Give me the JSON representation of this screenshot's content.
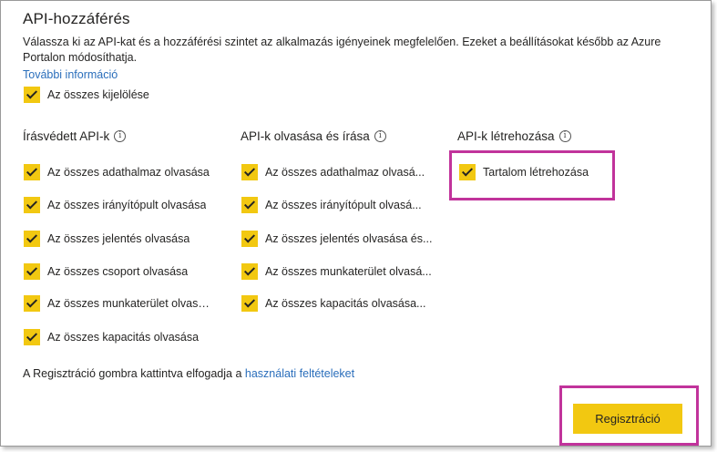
{
  "header": {
    "title": "API-hozzáférés",
    "description": "Válassza ki az API-kat és a hozzáférési szintet az alkalmazás igényeinek megfelelően. Ezeket a beállításokat később az Azure Portalon módosíthatja.",
    "more_info_link": "További információ"
  },
  "select_all": {
    "label": "Az összes kijelölése",
    "checked": true
  },
  "columns": [
    {
      "title": "Írásvédett API-k",
      "info_icon": "info-icon",
      "items": [
        {
          "label": "Az összes adathalmaz olvasása",
          "checked": true
        },
        {
          "label": "Az összes irányítópult olvasása",
          "checked": true
        },
        {
          "label": "Az összes jelentés olvasása",
          "checked": true
        },
        {
          "label": "Az összes csoport olvasása",
          "checked": true
        },
        {
          "label": "Az összes munkaterület olvasása",
          "checked": true
        },
        {
          "label": "Az összes kapacitás olvasása",
          "checked": true
        }
      ]
    },
    {
      "title": "API-k olvasása és írása",
      "info_icon": "info-icon",
      "items": [
        {
          "label": "Az összes adathalmaz olvasá...",
          "checked": true
        },
        {
          "label": "Az összes irányítópult olvasá...",
          "checked": true
        },
        {
          "label": "Az összes jelentés olvasása és...",
          "checked": true
        },
        {
          "label": "Az összes munkaterület olvasá...",
          "checked": true
        },
        {
          "label": "Az összes kapacitás olvasása...",
          "checked": true
        }
      ]
    },
    {
      "title": "API-k létrehozása",
      "info_icon": "info-icon",
      "items": [
        {
          "label": "Tartalom létrehozása",
          "checked": true
        }
      ]
    }
  ],
  "footer": {
    "terms_prefix": "A Regisztráció gombra kattintva elfogadja a ",
    "terms_link": "használati feltételeket",
    "register_button": "Regisztráció"
  },
  "colors": {
    "accent": "#f2c811",
    "highlight": "#c1339b",
    "link": "#2a6ebb"
  }
}
